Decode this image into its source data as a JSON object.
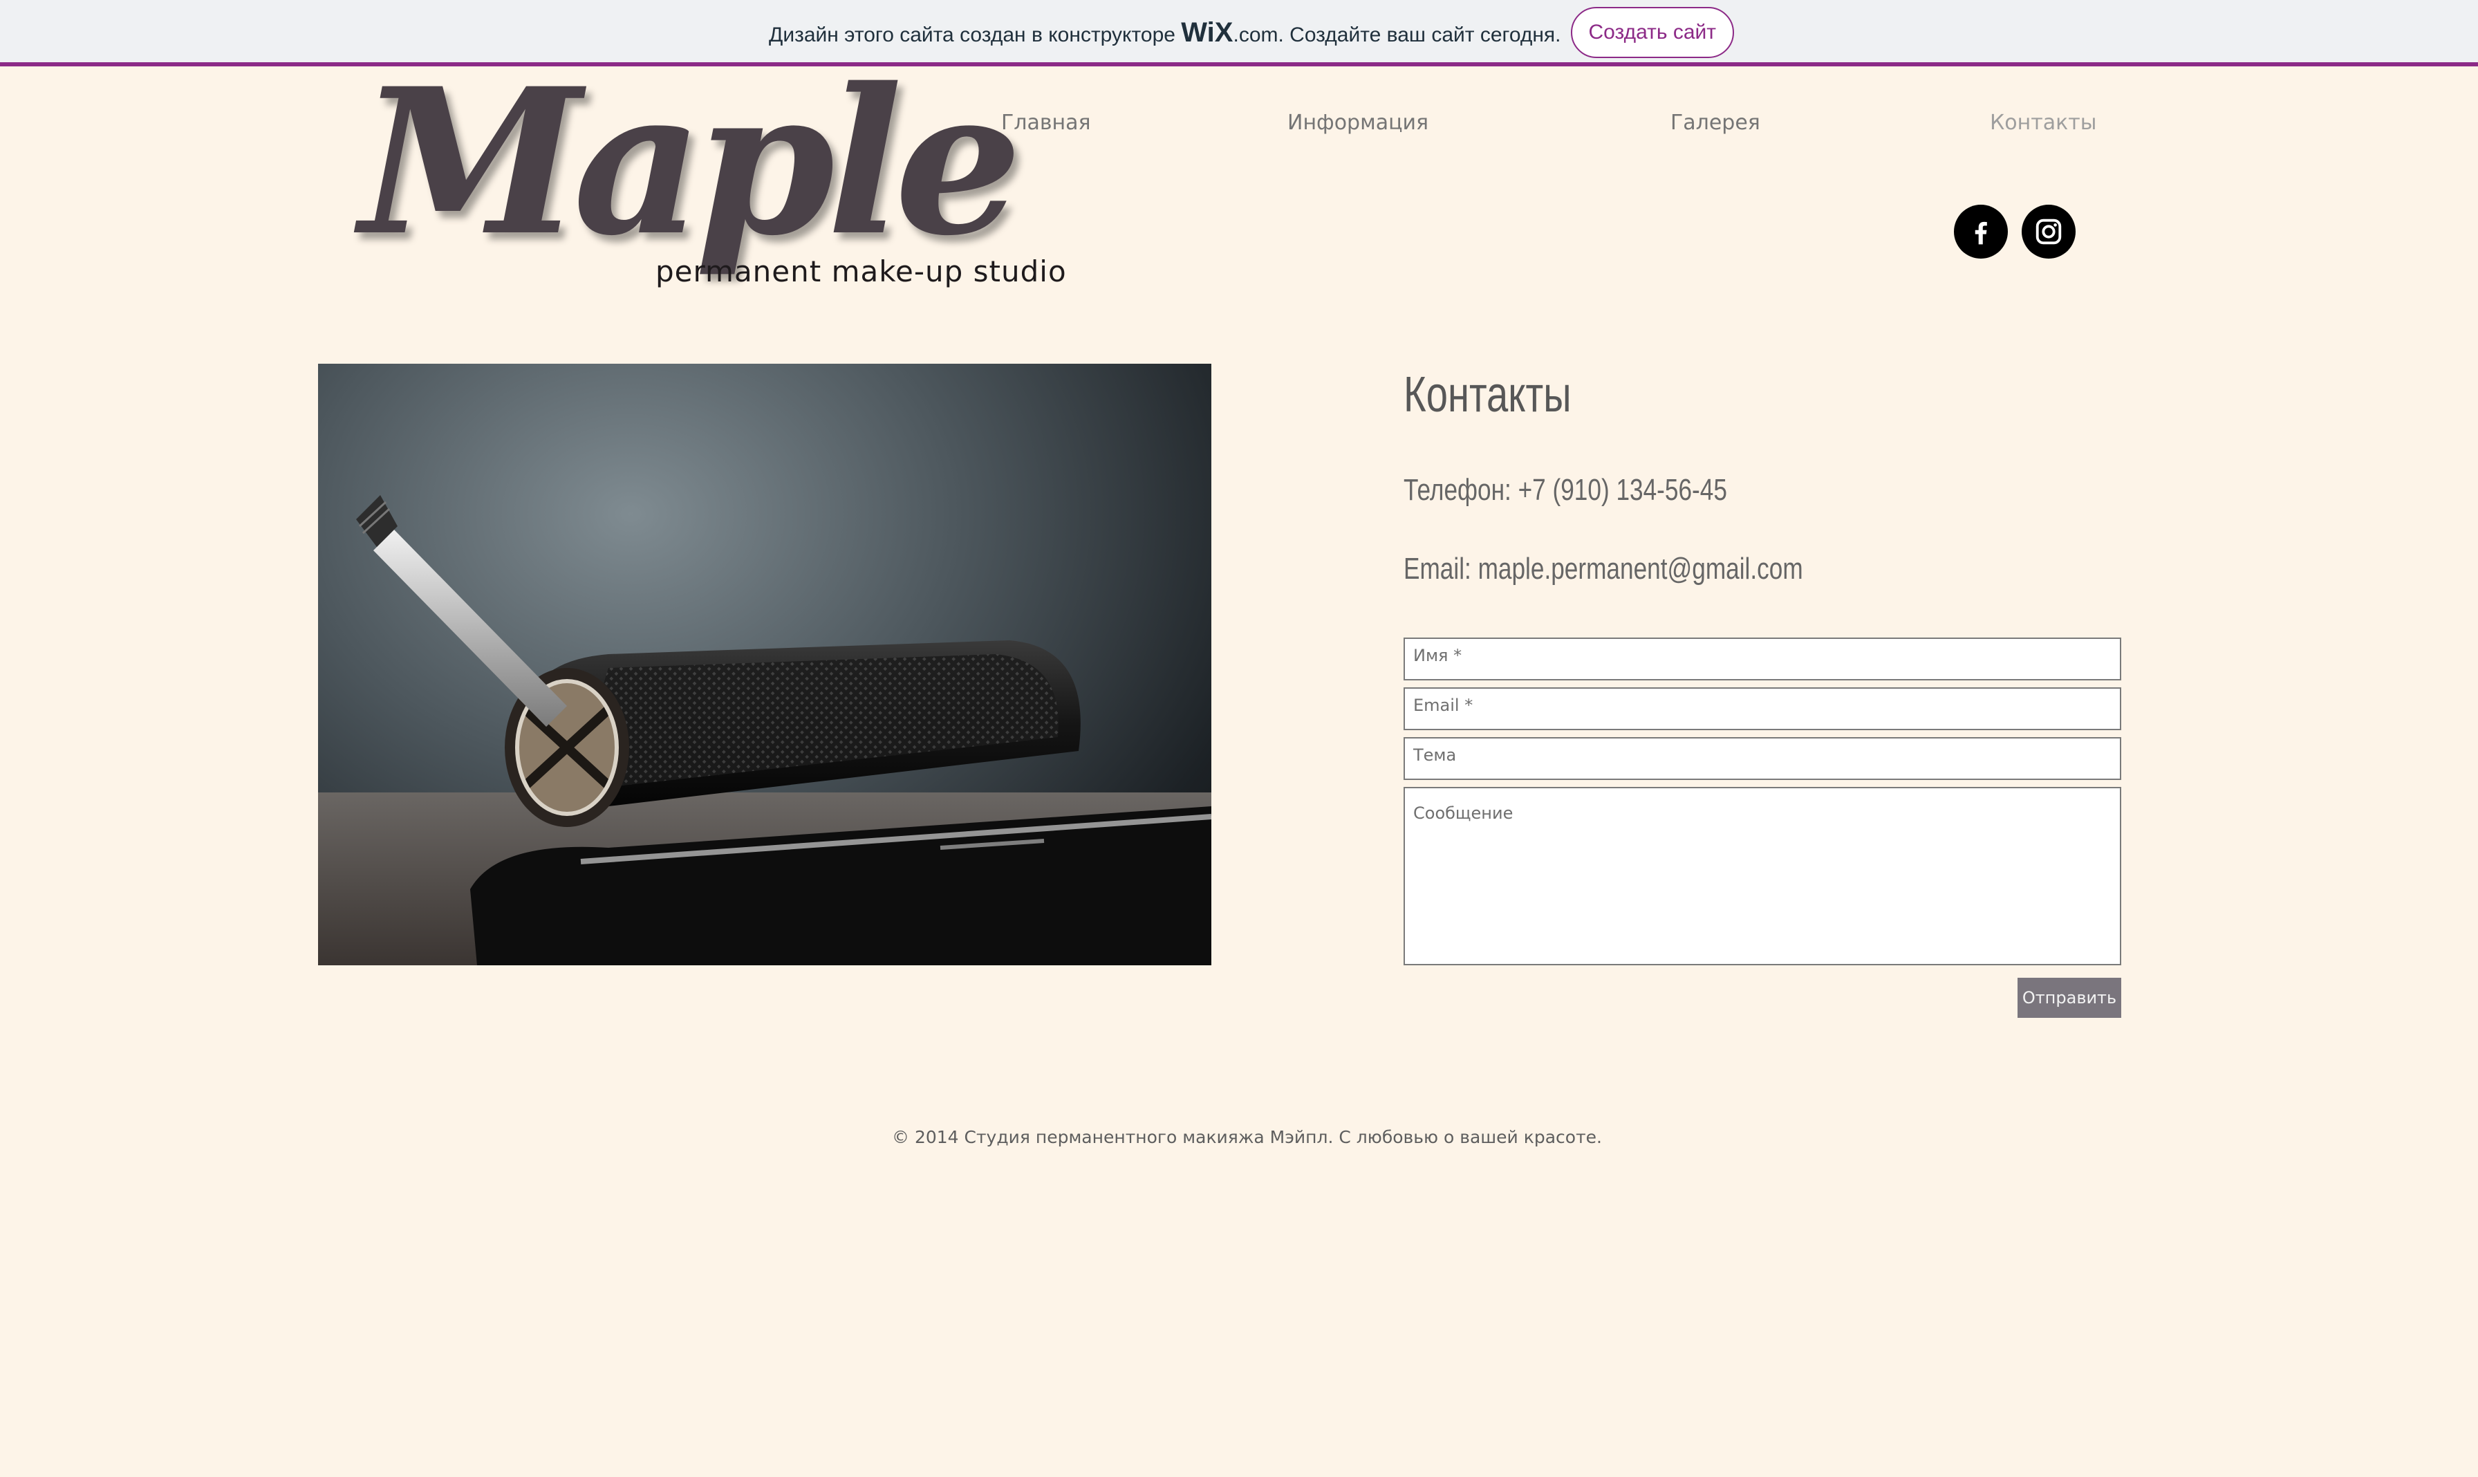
{
  "wix_banner": {
    "text_before": "Дизайн этого сайта создан в конструкторе ",
    "logo": "WiX",
    "text_after": ".com. Создайте ваш сайт сегодня.",
    "button": "Создать сайт"
  },
  "logo": {
    "script": "Maple",
    "tagline": "permanent  make-up studio"
  },
  "nav": {
    "items": [
      "Главная",
      "Информация",
      "Галерея",
      "Контакты"
    ],
    "active": "Контакты"
  },
  "social": {
    "icons": [
      "facebook-icon",
      "instagram-icon"
    ]
  },
  "contacts": {
    "title": "Контакты",
    "phone": "Телефон: +7 (910) 134-56-45",
    "email": "Email: maple.permanent@gmail.com"
  },
  "form": {
    "name_placeholder": "Имя *",
    "email_placeholder": "Email *",
    "subject_placeholder": "Тема",
    "message_placeholder": "Сообщение",
    "submit": "Отправить"
  },
  "footer": {
    "text": "© 2014 Студия перманентного макияжа Мэйпл. С любовью о вашей красоте."
  },
  "colors": {
    "background": "#fdf4e8",
    "wix_accent": "#8c2a87",
    "submit_button": "#7a757d"
  }
}
